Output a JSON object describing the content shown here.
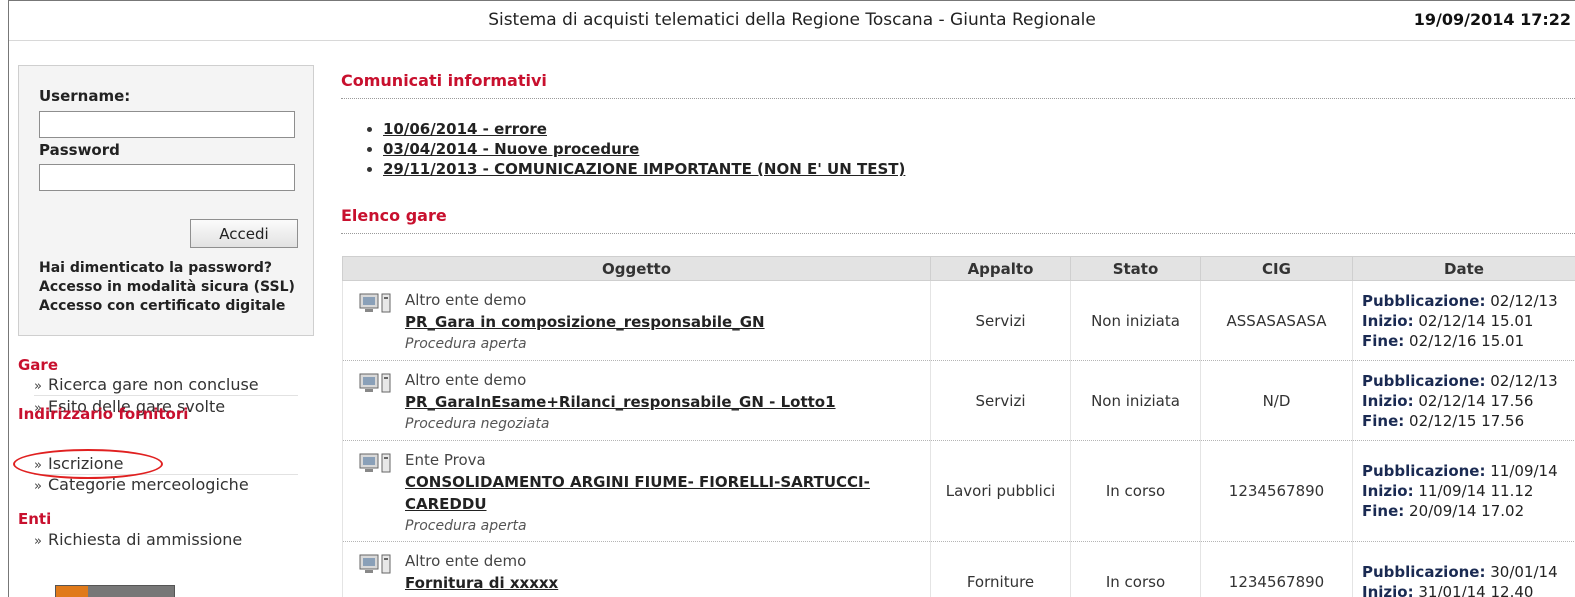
{
  "header": {
    "title": "Sistema di acquisti telematici della Regione Toscana - Giunta Regionale",
    "datetime": "19/09/2014 17:22"
  },
  "login": {
    "username_label": "Username:",
    "username_value": "",
    "password_label": "Password",
    "password_value": "",
    "submit_label": "Accedi",
    "links": [
      "Hai dimenticato la password?",
      "Accesso in modalità sicura (SSL)",
      "Accesso con certificato digitale"
    ]
  },
  "nav": {
    "sections": [
      {
        "title": "Gare",
        "items": [
          "Ricerca gare non concluse",
          "Esito delle gare svolte"
        ]
      },
      {
        "title": "Indirizzario fornitori",
        "items": [
          "Iscrizione",
          "Categorie merceologiche"
        ]
      },
      {
        "title": "Enti",
        "items": [
          "Richiesta di ammissione"
        ]
      }
    ],
    "highlighted_item": "Iscrizione"
  },
  "news": {
    "title": "Comunicati informativi",
    "items": [
      "10/06/2014 - errore",
      "03/04/2014 - Nuove procedure",
      "29/11/2013 - COMUNICAZIONE IMPORTANTE (NON E' UN TEST)"
    ]
  },
  "tenders": {
    "title": "Elenco gare",
    "columns": [
      "Oggetto",
      "Appalto",
      "Stato",
      "CIG",
      "Date"
    ],
    "rows": [
      {
        "ente": "Altro ente demo",
        "oggetto": "PR_Gara in composizione_responsabile_GN",
        "procedura": "Procedura aperta",
        "appalto": "Servizi",
        "stato": "Non iniziata",
        "cig": "ASSASASASA",
        "pubblicazione": "02/12/13",
        "inizio": "02/12/14 15.01",
        "fine": "02/12/16 15.01"
      },
      {
        "ente": "Altro ente demo",
        "oggetto": "PR_GaraInEsame+Rilanci_responsabile_GN - Lotto1",
        "procedura": "Procedura negoziata",
        "appalto": "Servizi",
        "stato": "Non iniziata",
        "cig": "N/D",
        "pubblicazione": "02/12/13",
        "inizio": "02/12/14 17.56",
        "fine": "02/12/15 17.56"
      },
      {
        "ente": "Ente Prova",
        "oggetto": "CONSOLIDAMENTO ARGINI FIUME- FIORELLI-SARTUCCI-CAREDDU",
        "procedura": "Procedura aperta",
        "appalto": "Lavori pubblici",
        "stato": "In corso",
        "cig": "1234567890",
        "pubblicazione": "11/09/14",
        "inizio": "11/09/14 11.12",
        "fine": "20/09/14 17.02"
      },
      {
        "ente": "Altro ente demo",
        "oggetto": "Fornitura di xxxxx",
        "procedura": "",
        "appalto": "Forniture",
        "stato": "In corso",
        "cig": "1234567890",
        "pubblicazione": "30/01/14",
        "inizio": "31/01/14 12.40",
        "fine": ""
      }
    ],
    "date_labels": {
      "pubblicazione": "Pubblicazione:",
      "inizio": "Inizio:",
      "fine": "Fine:"
    }
  },
  "colors": {
    "accent_red": "#c8102e",
    "header_bg": "#e3e3e3",
    "date_key": "#1a2a52"
  }
}
